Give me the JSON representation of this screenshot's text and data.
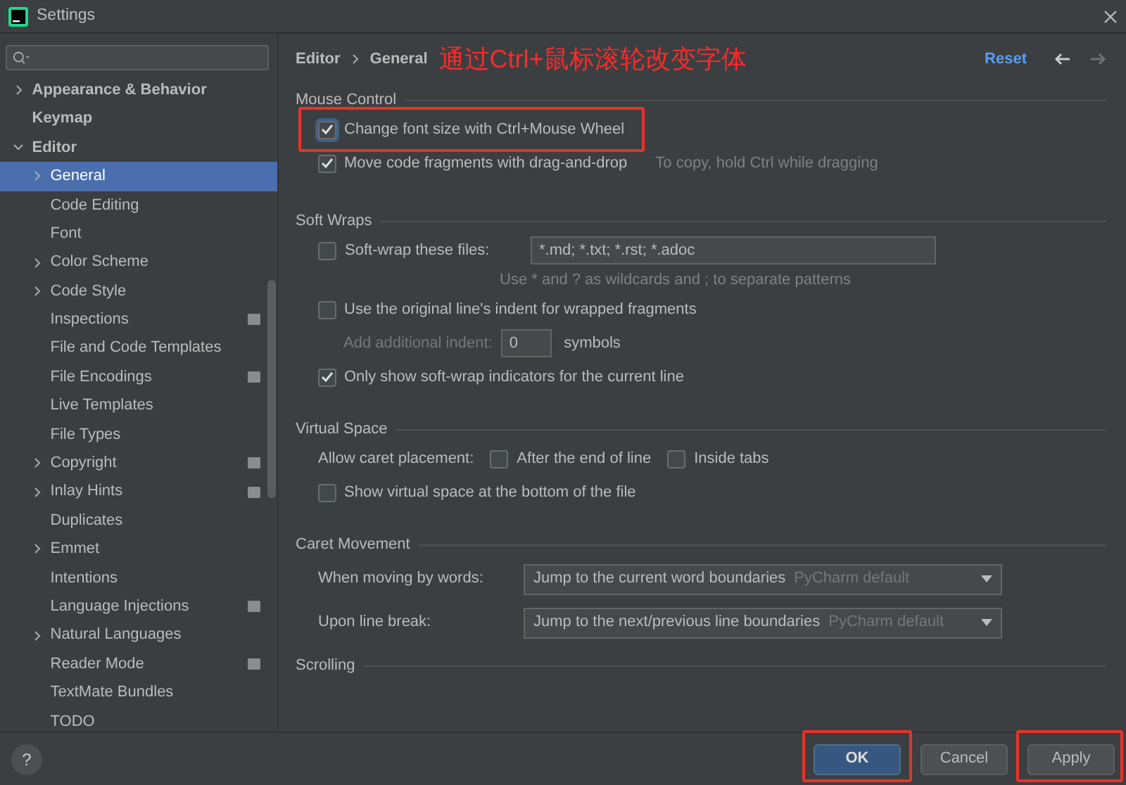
{
  "window": {
    "title": "Settings"
  },
  "sidebar": {
    "items": [
      {
        "label": "Appearance & Behavior",
        "has_children": true,
        "expanded": false,
        "bold": true,
        "selected": false,
        "project_icon": false
      },
      {
        "label": "Keymap",
        "has_children": false,
        "bold": true,
        "selected": false,
        "project_icon": false
      },
      {
        "label": "Editor",
        "has_children": true,
        "expanded": true,
        "bold": true,
        "selected": false,
        "project_icon": false,
        "children": [
          {
            "label": "General",
            "has_children": true,
            "expanded": false,
            "bold": false,
            "selected": true,
            "project_icon": false
          },
          {
            "label": "Code Editing",
            "has_children": false,
            "bold": false,
            "selected": false,
            "project_icon": false
          },
          {
            "label": "Font",
            "has_children": false,
            "bold": false,
            "selected": false,
            "project_icon": false
          },
          {
            "label": "Color Scheme",
            "has_children": true,
            "expanded": false,
            "bold": false,
            "selected": false,
            "project_icon": false
          },
          {
            "label": "Code Style",
            "has_children": true,
            "expanded": false,
            "bold": false,
            "selected": false,
            "project_icon": false
          },
          {
            "label": "Inspections",
            "has_children": false,
            "bold": false,
            "selected": false,
            "project_icon": true
          },
          {
            "label": "File and Code Templates",
            "has_children": false,
            "bold": false,
            "selected": false,
            "project_icon": false
          },
          {
            "label": "File Encodings",
            "has_children": false,
            "bold": false,
            "selected": false,
            "project_icon": true
          },
          {
            "label": "Live Templates",
            "has_children": false,
            "bold": false,
            "selected": false,
            "project_icon": false
          },
          {
            "label": "File Types",
            "has_children": false,
            "bold": false,
            "selected": false,
            "project_icon": false
          },
          {
            "label": "Copyright",
            "has_children": true,
            "expanded": false,
            "bold": false,
            "selected": false,
            "project_icon": true
          },
          {
            "label": "Inlay Hints",
            "has_children": true,
            "expanded": false,
            "bold": false,
            "selected": false,
            "project_icon": true
          },
          {
            "label": "Duplicates",
            "has_children": false,
            "bold": false,
            "selected": false,
            "project_icon": false
          },
          {
            "label": "Emmet",
            "has_children": true,
            "expanded": false,
            "bold": false,
            "selected": false,
            "project_icon": false
          },
          {
            "label": "Intentions",
            "has_children": false,
            "bold": false,
            "selected": false,
            "project_icon": false
          },
          {
            "label": "Language Injections",
            "has_children": false,
            "bold": false,
            "selected": false,
            "project_icon": true
          },
          {
            "label": "Natural Languages",
            "has_children": true,
            "expanded": false,
            "bold": false,
            "selected": false,
            "project_icon": false
          },
          {
            "label": "Reader Mode",
            "has_children": false,
            "bold": false,
            "selected": false,
            "project_icon": true
          },
          {
            "label": "TextMate Bundles",
            "has_children": false,
            "bold": false,
            "selected": false,
            "project_icon": false
          },
          {
            "label": "TODO",
            "has_children": false,
            "bold": false,
            "selected": false,
            "project_icon": false
          }
        ]
      }
    ]
  },
  "header": {
    "breadcrumb": [
      "Editor",
      "General"
    ],
    "annotation": "通过Ctrl+鼠标滚轮改变字体",
    "reset": "Reset",
    "back_disabled": false,
    "forward_disabled": true
  },
  "sections": [
    {
      "title": "Mouse Control",
      "rows": [
        {
          "kind": "checkbox",
          "label": "Change font size with Ctrl+Mouse Wheel",
          "checked": true,
          "focused": true,
          "highlighted": true
        },
        {
          "kind": "checkbox",
          "label": "Move code fragments with drag-and-drop",
          "checked": true,
          "hint": "To copy, hold Ctrl while dragging"
        }
      ]
    },
    {
      "title": "Soft Wraps",
      "rows": [
        {
          "kind": "checkbox_field",
          "label": "Soft-wrap these files:",
          "checked": false,
          "value": "*.md; *.txt; *.rst; *.adoc",
          "note": "Use * and ? as wildcards and ; to separate patterns"
        },
        {
          "kind": "checkbox",
          "label": "Use the original line's indent for wrapped fragments",
          "checked": false
        },
        {
          "kind": "number",
          "label": "Add additional indent:",
          "value": "0",
          "unit": "symbols",
          "disabled": true
        },
        {
          "kind": "checkbox",
          "label": "Only show soft-wrap indicators for the current line",
          "checked": true
        }
      ]
    },
    {
      "title": "Virtual Space",
      "rows": [
        {
          "kind": "inline_checks",
          "label": "Allow caret placement:",
          "checks": [
            {
              "label": "After the end of line",
              "checked": false
            },
            {
              "label": "Inside tabs",
              "checked": false
            }
          ]
        },
        {
          "kind": "checkbox",
          "label": "Show virtual space at the bottom of the file",
          "checked": false
        }
      ]
    },
    {
      "title": "Caret Movement",
      "rows": [
        {
          "kind": "select",
          "label": "When moving by words:",
          "value": "Jump to the current word boundaries",
          "note": "PyCharm default"
        },
        {
          "kind": "select",
          "label": "Upon line break:",
          "value": "Jump to the next/previous line boundaries",
          "note": "PyCharm default"
        }
      ]
    },
    {
      "title": "Scrolling"
    }
  ],
  "footer": {
    "help": "?",
    "buttons": [
      {
        "label": "OK",
        "primary": true,
        "highlighted": true
      },
      {
        "label": "Cancel",
        "primary": false,
        "highlighted": false
      },
      {
        "label": "Apply",
        "primary": false,
        "highlighted": true
      }
    ]
  }
}
